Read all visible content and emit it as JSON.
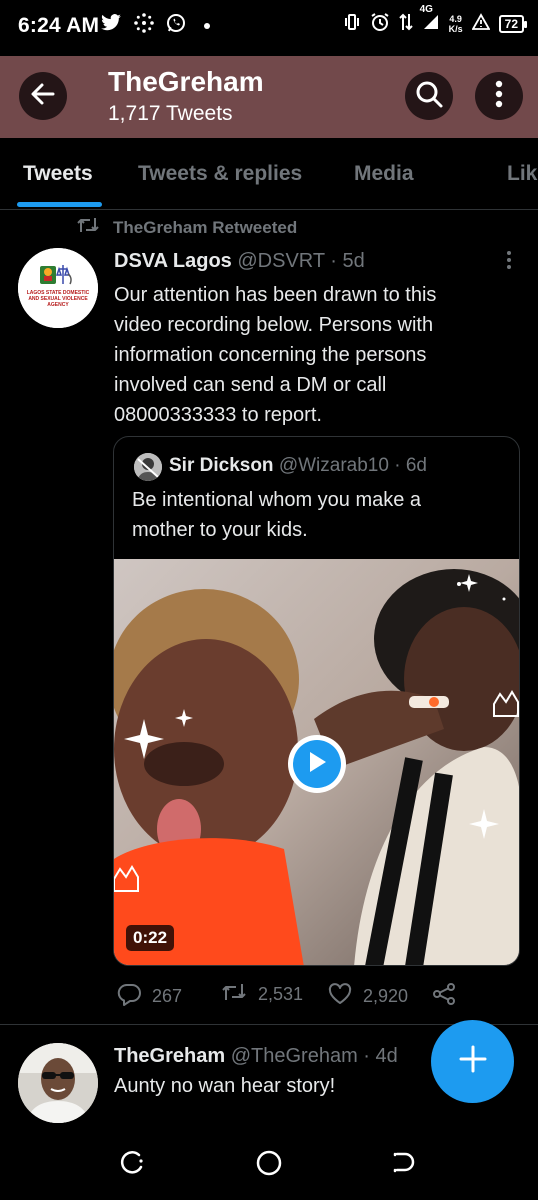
{
  "status_bar": {
    "time": "6:24 AM",
    "net_speed_value": "4.9",
    "net_speed_unit": "K/s",
    "network_type": "4G",
    "battery": "72",
    "icons": [
      "twitter-icon",
      "app-grid-icon",
      "whatsapp-icon",
      "notification-dot-icon",
      "vibrate-icon",
      "alarm-icon",
      "data-arrows-icon",
      "signal-icon",
      "warning-icon",
      "battery-icon"
    ]
  },
  "header": {
    "title": "TheGreham",
    "subtitle": "1,717 Tweets",
    "color": "#72494b"
  },
  "tabs": [
    {
      "label": "Tweets",
      "active": true
    },
    {
      "label": "Tweets & replies",
      "active": false
    },
    {
      "label": "Media",
      "active": false
    },
    {
      "label": "Likes",
      "active": false
    }
  ],
  "tweet1": {
    "retweet_label": "TheGreham Retweeted",
    "author_name": "DSVA Lagos",
    "handle": "@DSVRT",
    "separator": "·",
    "time": "5d",
    "lines": [
      "Our attention has been drawn to this",
      "video recording below. Persons with",
      "information concerning the persons",
      "involved can send a DM or call",
      "08000333333 to report."
    ],
    "avatar_logo_text": "LAGOS STATE DOMESTIC AND SEXUAL VIOLENCE AGENCY",
    "quoted": {
      "author_name": "Sir Dickson",
      "handle": "@Wizarab10",
      "separator": "·",
      "time": "6d",
      "lines": [
        "Be intentional whom you make a",
        "mother to your kids."
      ],
      "video_duration": "0:22"
    },
    "actions": {
      "replies": "267",
      "retweets": "2,531",
      "likes": "2,920"
    }
  },
  "tweet2": {
    "author_name": "TheGreham",
    "handle": "@TheGreham",
    "separator": "·",
    "time": "4d",
    "text": "Aunty no wan hear story!"
  },
  "colors": {
    "accent": "#1d9bf0",
    "muted": "#71767b",
    "text": "#e7e9ea",
    "border": "#2f3336"
  }
}
